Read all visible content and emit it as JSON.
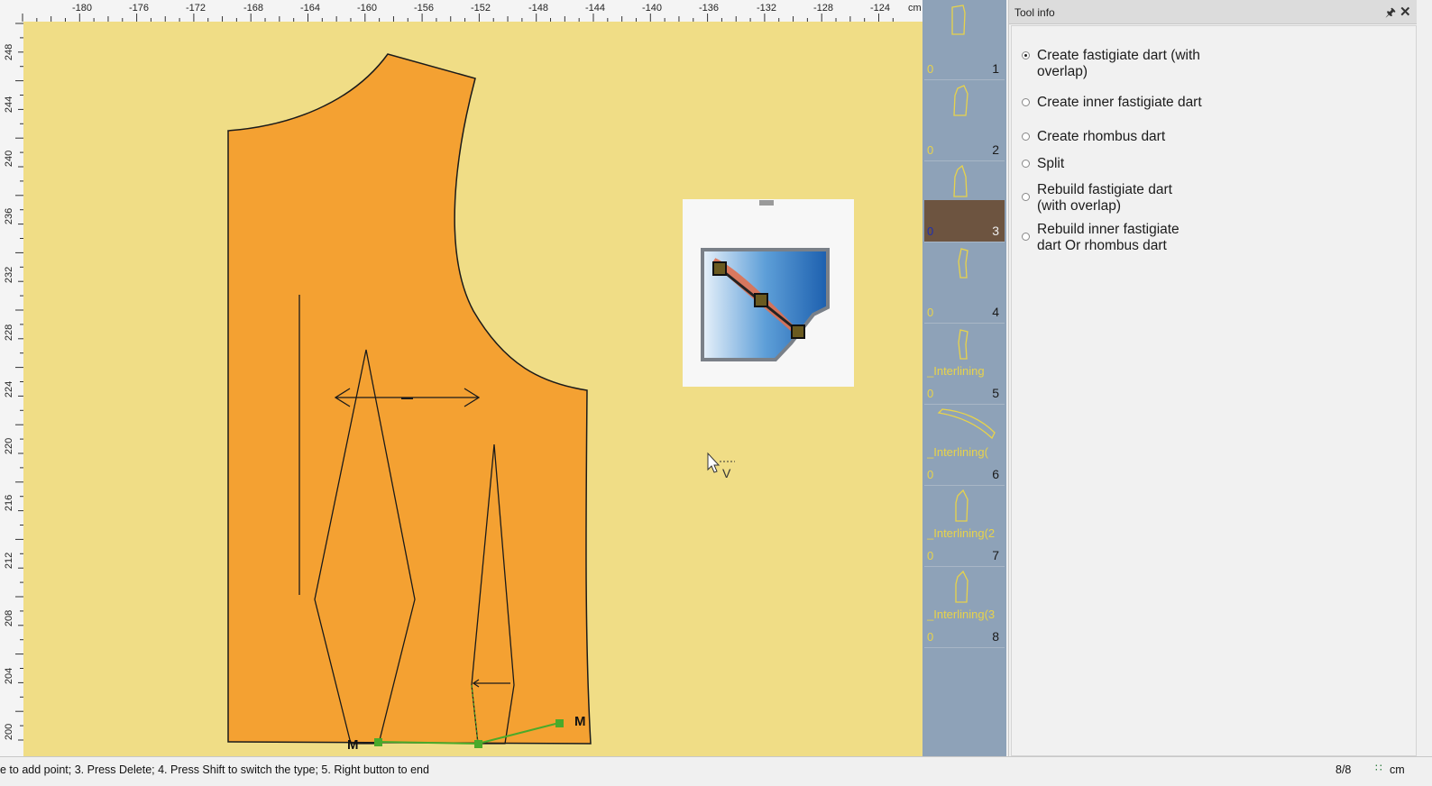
{
  "ruler": {
    "x_labels": [
      "-180",
      "-176",
      "-172",
      "-168",
      "-164",
      "-160",
      "-156",
      "-152",
      "-148",
      "-144",
      "-140",
      "-136",
      "-132",
      "-128",
      "-124"
    ],
    "unit": "cm",
    "y_labels": [
      "248",
      "244",
      "240",
      "236",
      "232",
      "228",
      "224",
      "220",
      "216",
      "212",
      "208",
      "204",
      "200"
    ]
  },
  "canvas": {
    "notch_marker_a": "M",
    "notch_marker_b": "M",
    "cursor_hint": "V"
  },
  "thumbnails": [
    {
      "zero": "0",
      "name": "",
      "num": "1"
    },
    {
      "zero": "0",
      "name": "",
      "num": "2"
    },
    {
      "zero": "0",
      "name": "",
      "num": "3",
      "selected": true
    },
    {
      "zero": "0",
      "name": "",
      "num": "4"
    },
    {
      "zero": "0",
      "name": "_Interlining",
      "num": "5"
    },
    {
      "zero": "0",
      "name": "_Interlining(",
      "num": "6"
    },
    {
      "zero": "0",
      "name": "_Interlining(2",
      "num": "7"
    },
    {
      "zero": "0",
      "name": "_Interlining(3",
      "num": "8"
    }
  ],
  "tool_info": {
    "title": "Tool info",
    "options": [
      {
        "label": "Create fastigiate dart (with\noverlap)",
        "selected": true
      },
      {
        "label": "Create inner fastigiate dart",
        "selected": false
      },
      {
        "label": "Create rhombus dart",
        "selected": false
      },
      {
        "label": "Split",
        "selected": false
      },
      {
        "label": "Rebuild fastigiate dart\n(with overlap)",
        "selected": false
      },
      {
        "label": "Rebuild inner fastigiate\ndart Or rhombus dart",
        "selected": false
      }
    ]
  },
  "status": {
    "hint": "e to add point; 3. Press Delete; 4. Press Shift to switch the type; 5. Right button to end",
    "page": "8/8",
    "unit": "cm"
  },
  "colors": {
    "canvas_bg": "#f0dd86",
    "piece_fill": "#f4a132",
    "thumb_panel": "#8ea2b8",
    "selected_thumb": "#6d5440",
    "point_green": "#4aaa2a"
  }
}
